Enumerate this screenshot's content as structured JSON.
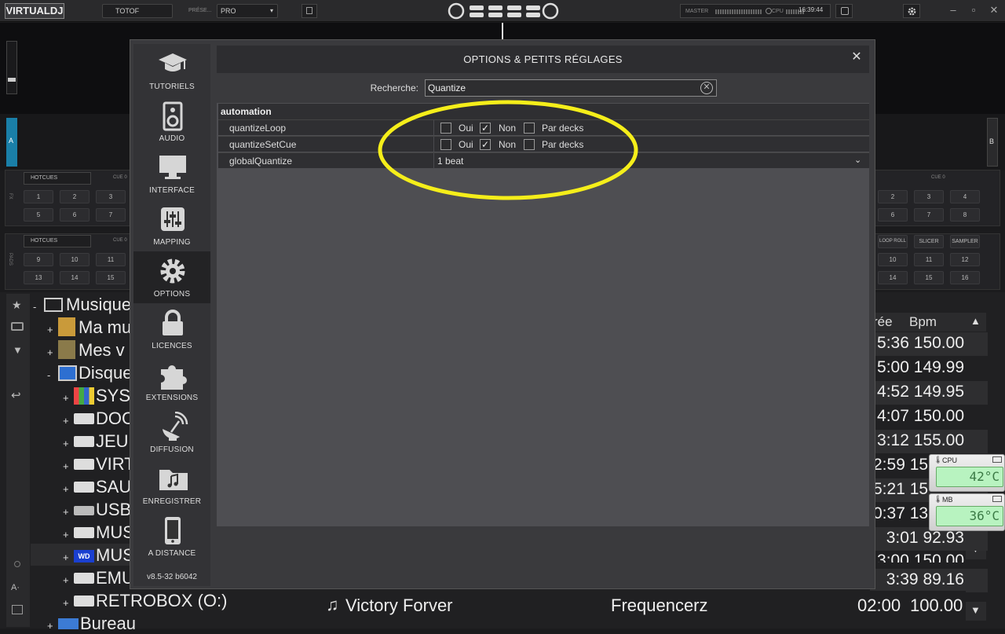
{
  "topbar": {
    "logo": "VIRTUALDJ",
    "user": "TOTOF",
    "preset_label": "PRÉSE...",
    "preset_value": "PRO",
    "master_label": "MASTER",
    "cpu_label": "CPU",
    "clock": "16:39:44"
  },
  "decks": {
    "left_label": "A",
    "right_label": "B",
    "hotcues_label": "HOTCUES",
    "cue_label": "CUE 0",
    "fx_label": "FX",
    "pads_label": "PADS",
    "pads_top": [
      "1",
      "2",
      "3",
      "5",
      "6",
      "7"
    ],
    "pads_bottom": [
      "9",
      "10",
      "11",
      "13",
      "14",
      "15"
    ],
    "right_pads_top": [
      "2",
      "3",
      "4",
      "6",
      "7",
      "8"
    ],
    "right_pads_bottom": [
      "10",
      "11",
      "12",
      "14",
      "15",
      "16"
    ],
    "right_modes": [
      "LOOP ROLL",
      "SLICER",
      "SAMPLER"
    ]
  },
  "browser": {
    "tree": [
      {
        "pm": "-",
        "label": "Musique"
      },
      {
        "pm": "+",
        "label": "Ma mu"
      },
      {
        "pm": "+",
        "label": "Mes v"
      },
      {
        "pm": "-",
        "label": "Disque"
      },
      {
        "pm": "+",
        "label": "SYS"
      },
      {
        "pm": "+",
        "label": "DOC"
      },
      {
        "pm": "+",
        "label": "JEU"
      },
      {
        "pm": "+",
        "label": "VIRT"
      },
      {
        "pm": "+",
        "label": "SAU"
      },
      {
        "pm": "+",
        "label": "USB"
      },
      {
        "pm": "+",
        "label": "MUS"
      },
      {
        "pm": "+",
        "label": "MUS"
      },
      {
        "pm": "+",
        "label": "EMU"
      },
      {
        "pm": "+",
        "label": "RETROBOX (O:)"
      },
      {
        "pm": "+",
        "label": "Bureau"
      }
    ],
    "col_duration_partial": "rée",
    "col_bpm": "Bpm",
    "rows": [
      {
        "dur": "5:36",
        "bpm": "150.00"
      },
      {
        "dur": "5:00",
        "bpm": "149.99"
      },
      {
        "dur": "4:52",
        "bpm": "149.95"
      },
      {
        "dur": "4:07",
        "bpm": "150.00"
      },
      {
        "dur": "3:12",
        "bpm": "155.00"
      },
      {
        "dur": "2:59",
        "bpm": "15"
      },
      {
        "dur": "5:21",
        "bpm": "15"
      },
      {
        "dur": "0:37",
        "bpm": "13"
      },
      {
        "dur": "3:01",
        "bpm": "92.93"
      },
      {
        "dur": "3:00",
        "bpm": "150.00"
      },
      {
        "dur": "3:39",
        "bpm": "89.16"
      }
    ],
    "last_row": {
      "title": "Victory Forver",
      "artist": "Frequencerz",
      "dur": "02:00",
      "bpm": "100.00"
    }
  },
  "dialog": {
    "title": "OPTIONS & PETITS RÉGLAGES",
    "search_label": "Recherche:",
    "search_value": "Quantize",
    "version": "v8.5-32 b6042",
    "nav": [
      {
        "label": "TUTORIELS",
        "icon": "graduation-cap-icon"
      },
      {
        "label": "AUDIO",
        "icon": "speaker-icon"
      },
      {
        "label": "INTERFACE",
        "icon": "monitor-icon"
      },
      {
        "label": "MAPPING",
        "icon": "sliders-icon"
      },
      {
        "label": "OPTIONS",
        "icon": "gear-icon"
      },
      {
        "label": "LICENCES",
        "icon": "lock-icon"
      },
      {
        "label": "EXTENSIONS",
        "icon": "puzzle-icon"
      },
      {
        "label": "DIFFUSION",
        "icon": "broadcast-dish-icon"
      },
      {
        "label": "ENREGISTRER",
        "icon": "music-folder-icon"
      },
      {
        "label": "A DISTANCE",
        "icon": "phone-icon"
      }
    ],
    "group": "automation",
    "options": [
      {
        "name": "quantizeLoop",
        "oui": "Oui",
        "non": "Non",
        "decks": "Par decks",
        "value": "non"
      },
      {
        "name": "quantizeSetCue",
        "oui": "Oui",
        "non": "Non",
        "decks": "Par decks",
        "value": "non"
      },
      {
        "name": "globalQuantize",
        "dropdown": "1 beat"
      }
    ],
    "highlight_color": "#f5ee1a"
  },
  "gadgets": [
    {
      "label": "CPU",
      "value": "42°C"
    },
    {
      "label": "MB",
      "value": "36°C"
    }
  ],
  "colors": {
    "accent_deck_a": "#1a7fa8"
  }
}
